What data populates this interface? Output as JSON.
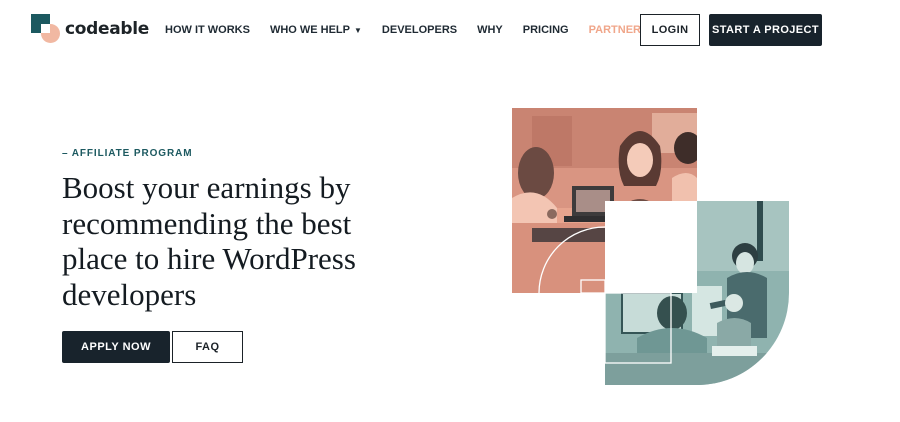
{
  "brand": {
    "name": "codeable",
    "logo_colors": {
      "teal": "#1c5960",
      "peach": "#f1b8a2"
    }
  },
  "nav": {
    "items": [
      {
        "label": "HOW IT WORKS",
        "has_dropdown": false
      },
      {
        "label": "WHO WE HELP",
        "has_dropdown": true
      },
      {
        "label": "DEVELOPERS",
        "has_dropdown": false
      },
      {
        "label": "WHY",
        "has_dropdown": false
      },
      {
        "label": "PRICING",
        "has_dropdown": false
      },
      {
        "label": "PARTNERS",
        "has_dropdown": true,
        "active": true
      }
    ],
    "dropdown_icon": "chevron-down-icon"
  },
  "header": {
    "login_label": "LOGIN",
    "start_label": "START A PROJECT"
  },
  "hero": {
    "eyebrow": "– AFFILIATE PROGRAM",
    "headline": "Boost your earnings by recommending the best place to hire WordPress developers",
    "apply_label": "APPLY NOW",
    "faq_label": "FAQ"
  },
  "illustration": {
    "top_photo_tint": "#e9a58f",
    "bottom_photo_tint": "#7fa6a3"
  },
  "colors": {
    "accent": "#f0a68a",
    "dark": "#18232c",
    "teal": "#1c5960"
  }
}
